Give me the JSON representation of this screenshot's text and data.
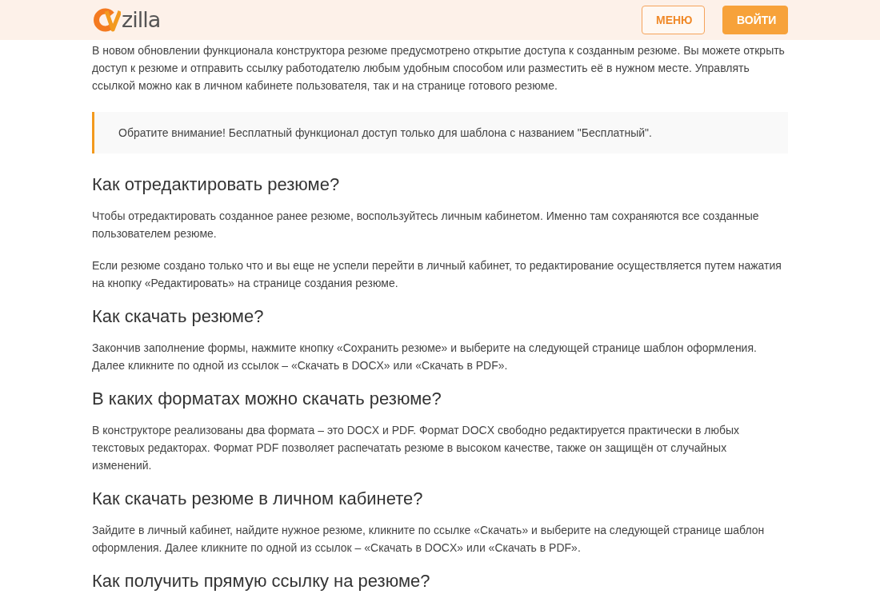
{
  "header": {
    "logo_text": "zilla",
    "buttons": [
      {
        "label": "МЕНЮ",
        "kind": "outline"
      },
      {
        "label": "ВОЙТИ",
        "kind": "filled"
      }
    ]
  },
  "content": [
    {
      "kind": "paragraph",
      "text": "В новом обновлении функционала конструктора резюме предусмотрено открытие доступа к созданным резюме. Вы можете открыть доступ к резюме и отправить ссылку работодателю любым удобным способом или разместить её в нужном месте. Управлять ссылкой можно как в личном кабинете пользователя, так и на странице готового резюме."
    },
    {
      "kind": "note",
      "text": "Обратите внимание! Бесплатный функционал доступ только для шаблона с названием \"Бесплатный\"."
    },
    {
      "kind": "heading",
      "text": "Как отредактировать резюме?"
    },
    {
      "kind": "paragraph",
      "text": "Чтобы отредактировать созданное ранее резюме, воспользуйтесь личным кабинетом. Именно там сохраняются все созданные пользователем резюме."
    },
    {
      "kind": "paragraph",
      "text": "Если резюме создано только что и вы еще не успели перейти в личный кабинет, то редактирование осуществляется путем нажатия на кнопку «Редактировать» на странице создания резюме."
    },
    {
      "kind": "heading",
      "text": "Как скачать резюме?"
    },
    {
      "kind": "paragraph",
      "text": "Закончив заполнение формы, нажмите кнопку «Сохранить резюме» и выберите на следующей странице шаблон оформления. Далее кликните по одной из ссылок – «Скачать в DOCX» или «Скачать в PDF»."
    },
    {
      "kind": "heading",
      "text": "В каких форматах можно скачать резюме?"
    },
    {
      "kind": "paragraph",
      "text": "В конструкторе реализованы два формата – это DOCX и PDF. Формат DOCX свободно редактируется практически в любых текстовых редакторах. Формат PDF позволяет распечатать резюме в высоком качестве, также он защищён от случайных изменений."
    },
    {
      "kind": "heading",
      "text": "Как скачать резюме в личном кабинете?"
    },
    {
      "kind": "paragraph",
      "text": "Зайдите в личный кабинет, найдите нужное резюме, кликните по ссылке «Скачать» и выберите на следующей странице шаблон оформления. Далее кликните по одной из ссылок – «Скачать в DOCX» или «Скачать в PDF»."
    },
    {
      "kind": "heading",
      "text": "Как получить прямую ссылку на резюме?"
    }
  ]
}
